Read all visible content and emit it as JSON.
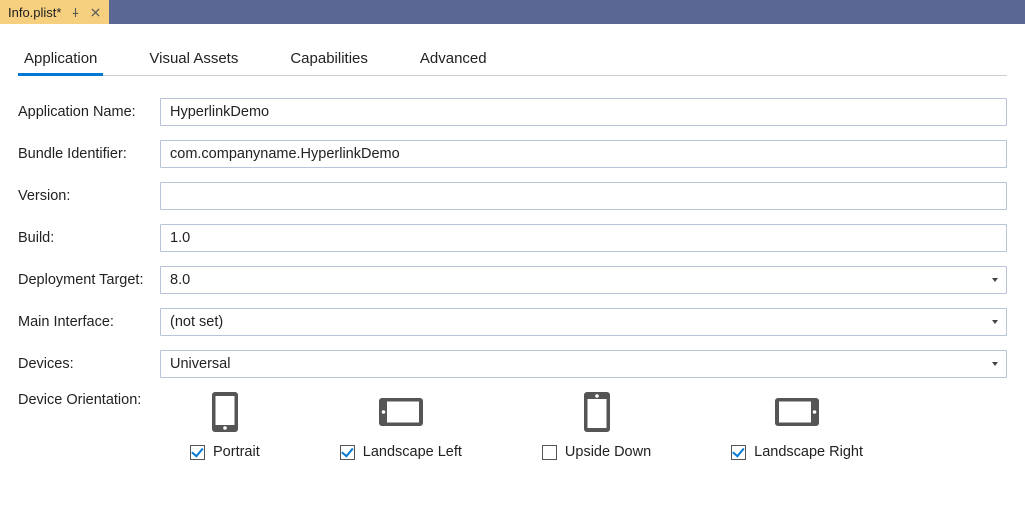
{
  "file_tab": {
    "title": "Info.plist*"
  },
  "tabs": {
    "application": "Application",
    "visual_assets": "Visual Assets",
    "capabilities": "Capabilities",
    "advanced": "Advanced"
  },
  "form": {
    "app_name": {
      "label": "Application Name:",
      "value": "HyperlinkDemo"
    },
    "bundle_id": {
      "label": "Bundle Identifier:",
      "value": "com.companyname.HyperlinkDemo"
    },
    "version": {
      "label": "Version:",
      "value": ""
    },
    "build": {
      "label": "Build:",
      "value": "1.0"
    },
    "deploy": {
      "label": "Deployment Target:",
      "value": "8.0"
    },
    "main_if": {
      "label": "Main Interface:",
      "value": "(not set)"
    },
    "devices": {
      "label": "Devices:",
      "value": "Universal"
    },
    "orient": {
      "label": "Device Orientation:"
    }
  },
  "orientations": {
    "portrait": {
      "label": "Portrait",
      "checked": true
    },
    "landscape_left": {
      "label": "Landscape Left",
      "checked": true
    },
    "upside_down": {
      "label": "Upside Down",
      "checked": false
    },
    "landscape_right": {
      "label": "Landscape Right",
      "checked": true
    }
  }
}
